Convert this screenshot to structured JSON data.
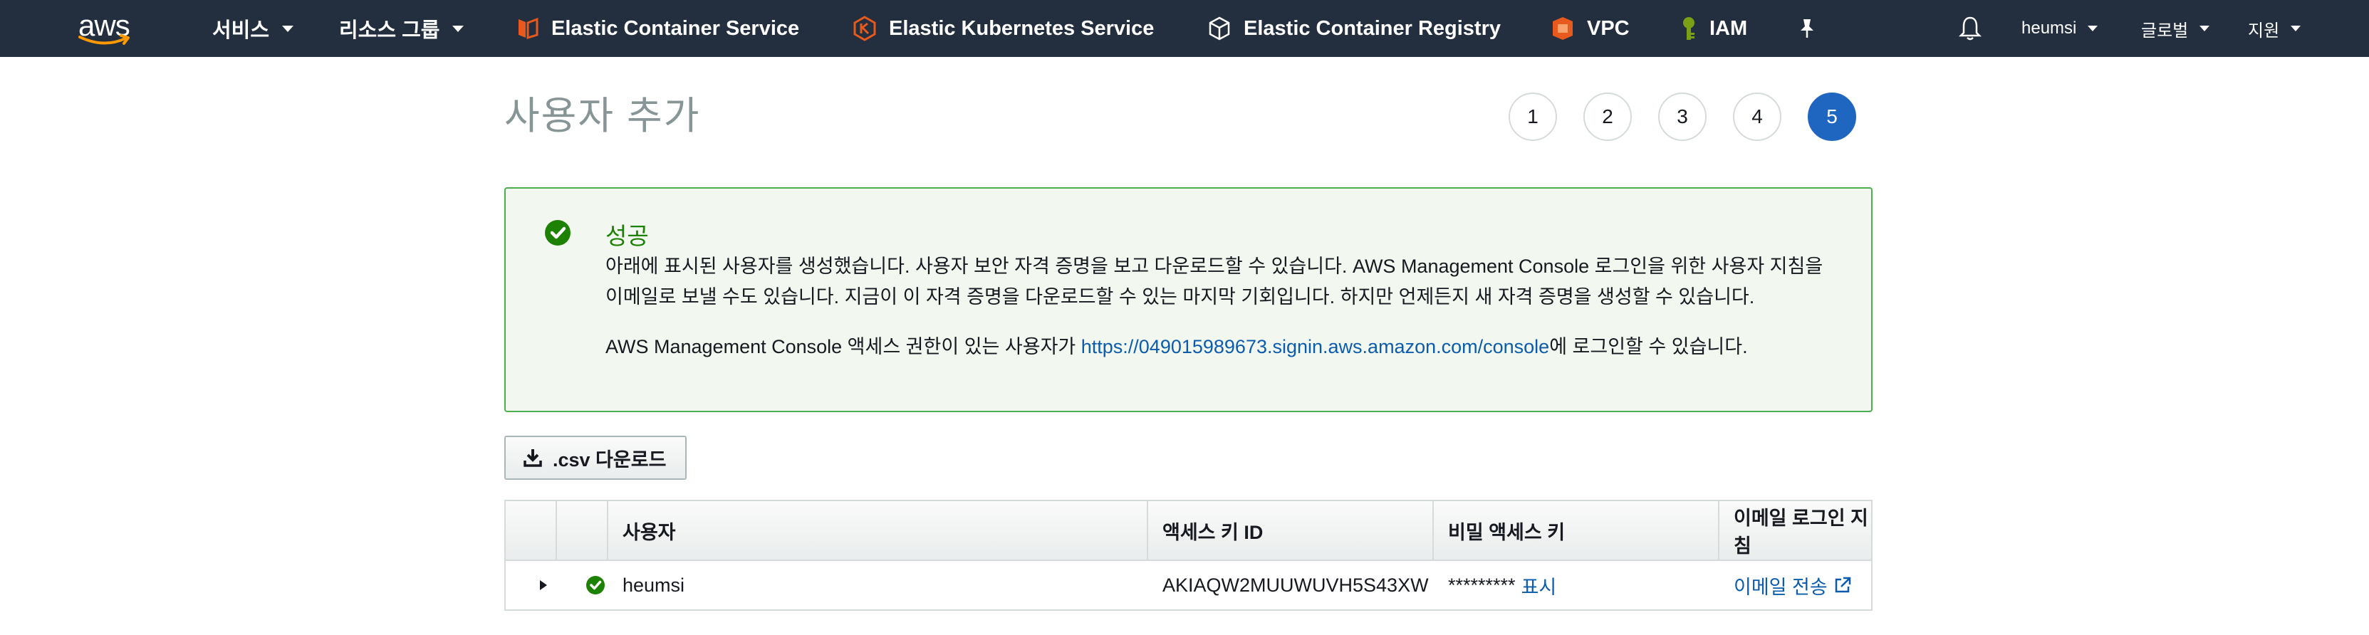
{
  "topnav": {
    "logo_text": "aws",
    "services_label": "서비스",
    "resource_groups_label": "리소스 그룹",
    "pinned": [
      {
        "label": "Elastic Container Service",
        "icon": "ecs-icon",
        "color": "#e7591c"
      },
      {
        "label": "Elastic Kubernetes Service",
        "icon": "eks-icon",
        "color": "#e7591c"
      },
      {
        "label": "Elastic Container Registry",
        "icon": "ecr-icon",
        "color": "#ffffff"
      },
      {
        "label": "VPC",
        "icon": "vpc-icon",
        "color": "#e7591c"
      },
      {
        "label": "IAM",
        "icon": "iam-icon",
        "color": "#7aa116"
      }
    ],
    "account_label": "heumsi",
    "region_label": "글로벌",
    "support_label": "지원"
  },
  "page": {
    "title": "사용자 추가",
    "steps": [
      "1",
      "2",
      "3",
      "4",
      "5"
    ],
    "active_step": "5"
  },
  "success": {
    "title": "성공",
    "message": "아래에 표시된 사용자를 생성했습니다. 사용자 보안 자격 증명을 보고 다운로드할 수 있습니다. AWS Management Console 로그인을 위한 사용자 지침을 이메일로 보낼 수도 있습니다. 지금이 이 자격 증명을 다운로드할 수 있는 마지막 기회입니다. 하지만 언제든지 새 자격 증명을 생성할 수 있습니다.",
    "url_prefix": "AWS Management Console 액세스 권한이 있는 사용자가 ",
    "url": "https://049015989673.signin.aws.amazon.com/console",
    "url_suffix": "에 로그인할 수 있습니다."
  },
  "actions": {
    "csv_download_label": ".csv 다운로드"
  },
  "table": {
    "columns": [
      "사용자",
      "액세스 키 ID",
      "비밀 액세스 키",
      "이메일 로그인 지침"
    ],
    "rows": [
      {
        "user": "heumsi",
        "access_key_id": "AKIAQW2MUUWUVH5S43XW",
        "secret_masked": "*********",
        "show_label": "표시",
        "email_label": "이메일 전송"
      }
    ]
  },
  "colors": {
    "nav_bg": "#232f3e",
    "accent": "#1f66c1",
    "success": "#1d8102",
    "link": "#0b5cad"
  }
}
